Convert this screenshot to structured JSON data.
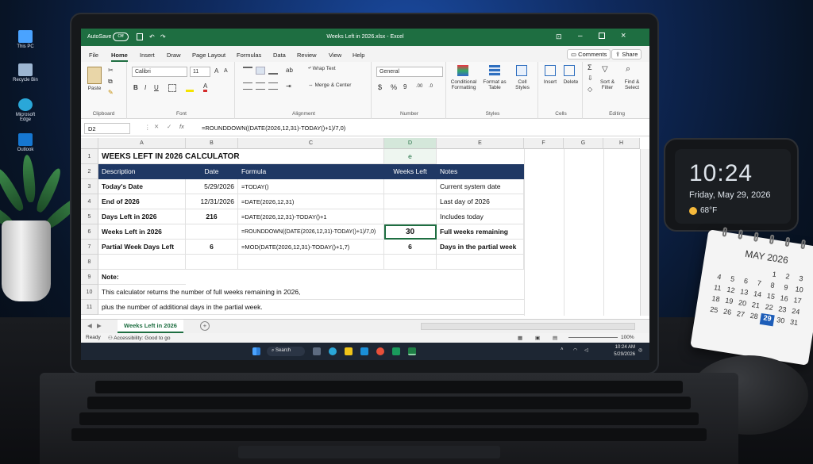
{
  "desktop": {
    "icons": [
      {
        "label": "This PC"
      },
      {
        "label": "Recycle Bin"
      },
      {
        "label": "Microsoft Edge"
      },
      {
        "label": "Outlook"
      }
    ]
  },
  "clock_widget": {
    "time": "10:24",
    "date": "Friday, May 29, 2026",
    "weather": "68°F"
  },
  "calendar_widget": {
    "month": "MAY 2026",
    "days": [
      "",
      "",
      "",
      "",
      "1",
      "2",
      "3",
      "4",
      "5",
      "6",
      "7",
      "8",
      "9",
      "10",
      "11",
      "12",
      "13",
      "14",
      "15",
      "16",
      "17",
      "18",
      "19",
      "20",
      "21",
      "22",
      "23",
      "24",
      "25",
      "26",
      "27",
      "28",
      "29",
      "30",
      "31"
    ],
    "highlight": "29"
  },
  "excel": {
    "titlebar": {
      "autosave": "AutoSave",
      "toggle": "Off",
      "title": "Weeks Left in 2026.xlsx - Excel"
    },
    "ribbon_tabs": [
      "File",
      "Home",
      "Insert",
      "Draw",
      "Page Layout",
      "Formulas",
      "Data",
      "Review",
      "View",
      "Help"
    ],
    "active_tab": "Home",
    "comments_label": "Comments",
    "share_label": "Share",
    "ribbon": {
      "clipboard": {
        "paste": "Paste",
        "label": "Clipboard"
      },
      "font": {
        "name": "Calibri",
        "size": "11",
        "label": "Font"
      },
      "alignment": {
        "wrap": "Wrap Text",
        "merge": "Merge & Center",
        "label": "Alignment"
      },
      "number": {
        "format": "General",
        "label": "Number"
      },
      "styles": {
        "cond": "Conditional Formatting",
        "table": "Format as Table",
        "cell": "Cell Styles",
        "label": "Styles"
      },
      "cells": {
        "insert": "Insert",
        "delete": "Delete",
        "label": "Cells"
      },
      "editing": {
        "sort": "Sort & Filter",
        "find": "Find & Select",
        "label": "Editing"
      }
    },
    "name_box": "D2",
    "formula": "=ROUNDDOWN((DATE(2026,12,31)-TODAY()+1)/7,0)",
    "columns": [
      "A",
      "B",
      "C",
      "D",
      "E",
      "F",
      "G",
      "H"
    ],
    "rows": [
      "1",
      "2",
      "3",
      "4",
      "5",
      "6",
      "7",
      "8",
      "9",
      "10",
      "11"
    ],
    "cells": {
      "title": "WEEKS LEFT IN 2026 CALCULATOR",
      "d1": "e",
      "headers": [
        "Description",
        "Date",
        "Formula",
        "Weeks Left",
        "Notes"
      ],
      "data": [
        [
          "Today's Date",
          "5/29/2026",
          "=TODAY()",
          "",
          "Current system date"
        ],
        [
          "End of 2026",
          "12/31/2026",
          "=DATE(2026,12,31)",
          "",
          "Last day of 2026"
        ],
        [
          "Days Left in 2026",
          "216",
          "=DATE(2026,12,31)-TODAY()+1",
          "",
          "Includes today"
        ],
        [
          "Weeks Left in 2026",
          "",
          "=ROUNDDOWN((DATE(2026,12,31)-TODAY()+1)/7,0)",
          "30",
          "Full weeks remaining"
        ],
        [
          "Partial Week Days Left",
          "6",
          "=MOD(DATE(2026,12,31)-TODAY()+1,7)",
          "6",
          "Days in the partial week"
        ]
      ],
      "note_label": "Note:",
      "note_line1": "This calculator returns the number of full weeks remaining in 2026,",
      "note_line2": "plus the number of additional days in the partial week."
    },
    "sheet_tab": "Weeks Left in 2026",
    "status": {
      "ready": "Ready",
      "accessibility": "Accessibility: Good to go",
      "zoom": "100%"
    },
    "taskbar": {
      "search": "Search",
      "time": "10:24 AM",
      "date": "5/29/2026"
    }
  }
}
